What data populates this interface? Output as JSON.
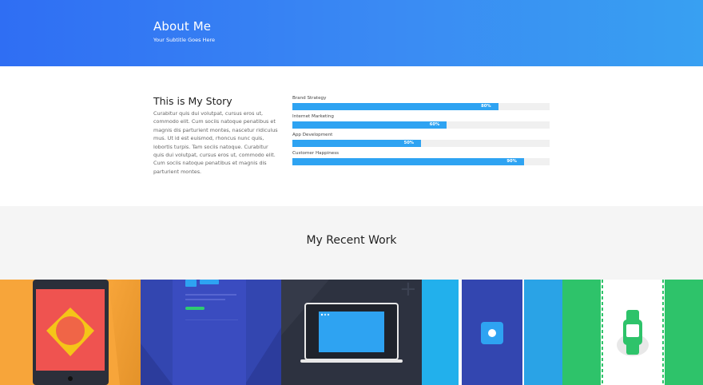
{
  "hero": {
    "title": "About Me",
    "subtitle": "Your Subtitle Goes Here"
  },
  "story": {
    "title": "This is My Story",
    "body": "Curabitur quis dui volutpat, cursus eros ut, commodo elit. Cum sociis natoque penatibus et magnis dis parturient montes, nascetur ridiculus mus. Ut id est euismod, rhoncus nunc quis, lobortis turpis. Tam sociis natoque. Curabitur quis dui volutpat, cursus eros ut, commodo elit. Cum sociis natoque penatibus et magnis dis parturient montes."
  },
  "skills": [
    {
      "label": "Brand Strategy",
      "percent_label": "80%",
      "value": 80
    },
    {
      "label": "Internet Marketing",
      "percent_label": "60%",
      "value": 60
    },
    {
      "label": "App Development",
      "percent_label": "50%",
      "value": 50
    },
    {
      "label": "Customer Happiness",
      "percent_label": "90%",
      "value": 90
    }
  ],
  "work": {
    "title": "My Recent Work"
  },
  "colors": {
    "hero_start": "#2f6ef3",
    "hero_end": "#38a0f2",
    "bar_fill": "#2ea3f2",
    "bar_track": "#f0f0f0",
    "work_bg": "#f5f5f5"
  },
  "portfolio": [
    {
      "name": "tablet-shapes-thumbnail",
      "icon": "tablet-icon"
    },
    {
      "name": "mobile-ui-thumbnail",
      "icon": "phone-screen-icon"
    },
    {
      "name": "laptop-thumbnail",
      "icon": "laptop-icon"
    },
    {
      "name": "blue-phone-thumbnail",
      "icon": "circle-button-icon"
    },
    {
      "name": "smartwatch-thumbnail",
      "icon": "watch-icon"
    }
  ]
}
